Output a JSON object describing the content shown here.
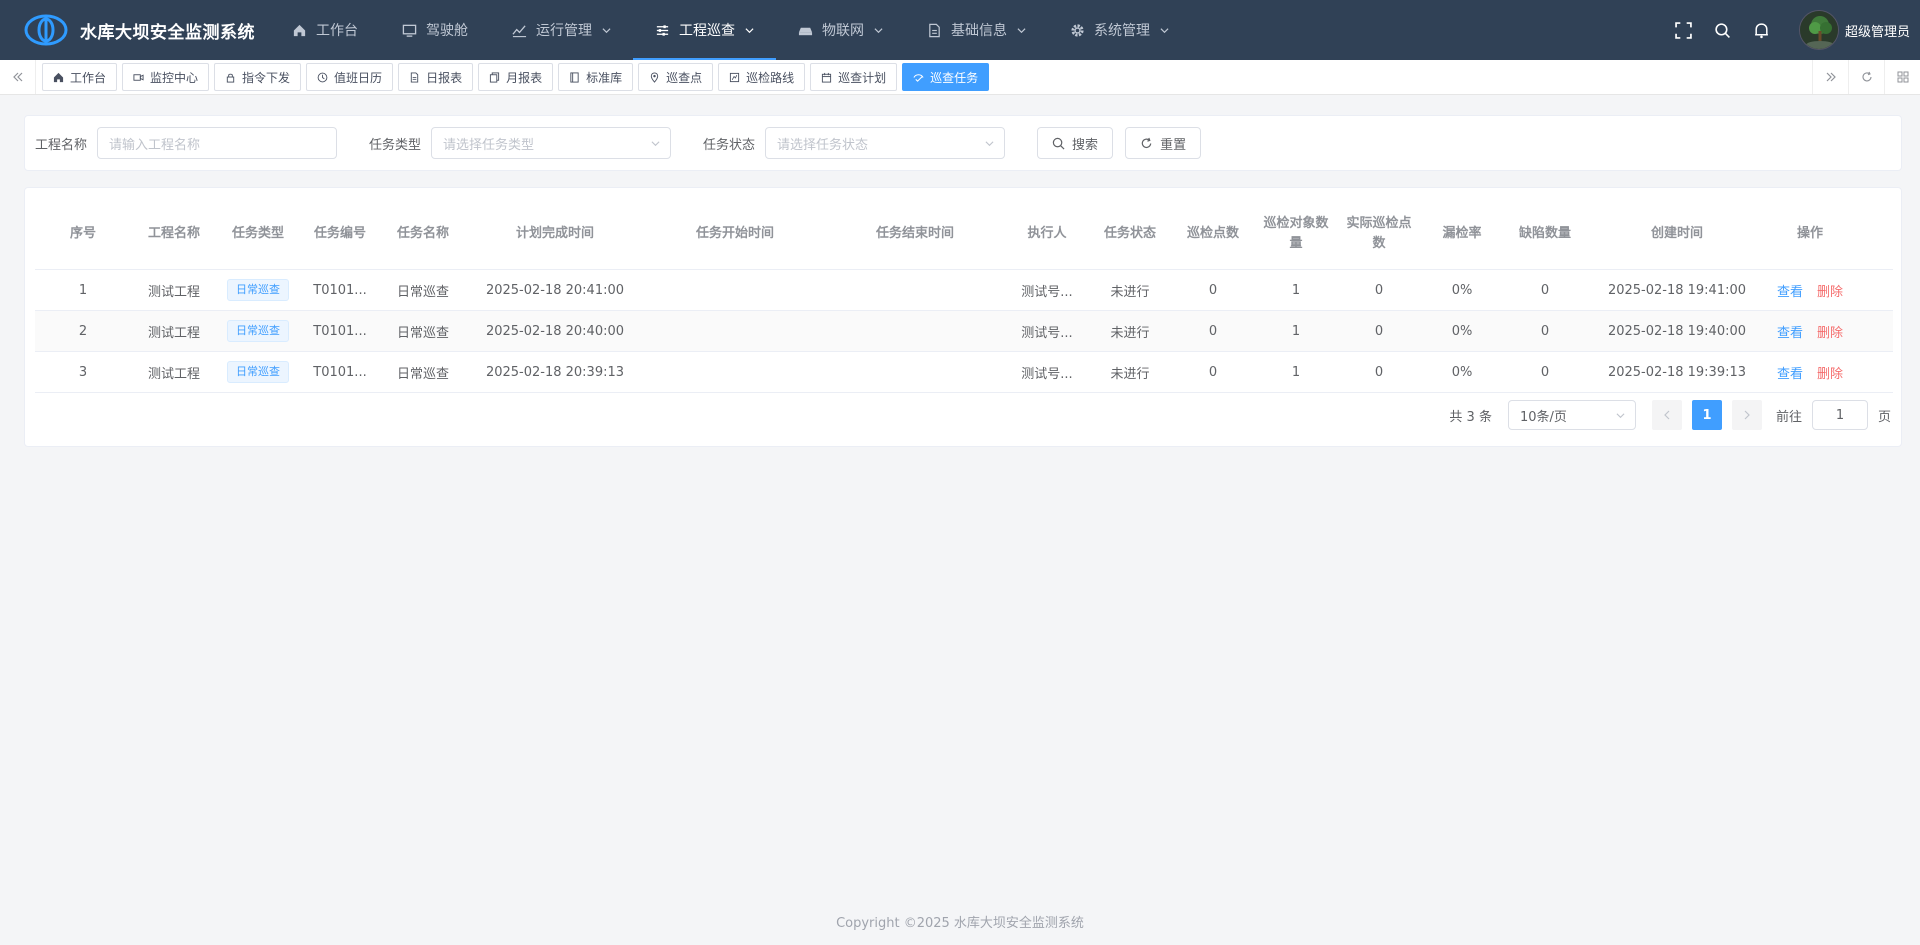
{
  "app": {
    "title": "水库大坝安全监测系统"
  },
  "nav": [
    {
      "label": "工作台",
      "icon": "home-icon",
      "dropdown": false,
      "active": false
    },
    {
      "label": "驾驶舱",
      "icon": "monitor-icon",
      "dropdown": false,
      "active": false
    },
    {
      "label": "运行管理",
      "icon": "chart-line-icon",
      "dropdown": true,
      "active": false
    },
    {
      "label": "工程巡查",
      "icon": "sliders-icon",
      "dropdown": true,
      "active": true
    },
    {
      "label": "物联网",
      "icon": "device-icon",
      "dropdown": true,
      "active": false
    },
    {
      "label": "基础信息",
      "icon": "document-icon",
      "dropdown": true,
      "active": false
    },
    {
      "label": "系统管理",
      "icon": "gear-icon",
      "dropdown": true,
      "active": false
    }
  ],
  "user": {
    "name": "超级管理员"
  },
  "tabs": [
    {
      "label": "工作台",
      "icon": "home-icon",
      "active": false
    },
    {
      "label": "监控中心",
      "icon": "camera-icon",
      "active": false
    },
    {
      "label": "指令下发",
      "icon": "lock-icon",
      "active": false
    },
    {
      "label": "值班日历",
      "icon": "clock-icon",
      "active": false
    },
    {
      "label": "日报表",
      "icon": "document-icon",
      "active": false
    },
    {
      "label": "月报表",
      "icon": "copy-icon",
      "active": false
    },
    {
      "label": "标准库",
      "icon": "book-icon",
      "active": false
    },
    {
      "label": "巡查点",
      "icon": "location-icon",
      "active": false
    },
    {
      "label": "巡检路线",
      "icon": "route-icon",
      "active": false
    },
    {
      "label": "巡查计划",
      "icon": "calendar-icon",
      "active": false
    },
    {
      "label": "巡查任务",
      "icon": "task-icon",
      "active": true
    }
  ],
  "search": {
    "project_label": "工程名称",
    "project_placeholder": "请输入工程名称",
    "type_label": "任务类型",
    "type_placeholder": "请选择任务类型",
    "status_label": "任务状态",
    "status_placeholder": "请选择任务状态",
    "search_btn": "搜索",
    "reset_btn": "重置"
  },
  "table": {
    "headers": [
      "序号",
      "工程名称",
      "任务类型",
      "任务编号",
      "任务名称",
      "计划完成时间",
      "任务开始时间",
      "任务结束时间",
      "执行人",
      "任务状态",
      "巡检点数",
      "巡检对象数量",
      "实际巡检点数",
      "漏检率",
      "缺陷数量",
      "创建时间",
      "操作"
    ],
    "rows": [
      {
        "idx": "1",
        "project": "测试工程",
        "type": "日常巡查",
        "code": "T0101...",
        "name": "日常巡查",
        "plan_time": "2025-02-18 20:41:00",
        "start": "",
        "end": "",
        "executor": "测试号...",
        "status": "未进行",
        "points": "0",
        "objects": "1",
        "actual": "0",
        "miss_rate": "0%",
        "defects": "0",
        "created": "2025-02-18 19:41:00",
        "view": "查看",
        "del": "删除"
      },
      {
        "idx": "2",
        "project": "测试工程",
        "type": "日常巡查",
        "code": "T0101...",
        "name": "日常巡查",
        "plan_time": "2025-02-18 20:40:00",
        "start": "",
        "end": "",
        "executor": "测试号...",
        "status": "未进行",
        "points": "0",
        "objects": "1",
        "actual": "0",
        "miss_rate": "0%",
        "defects": "0",
        "created": "2025-02-18 19:40:00",
        "view": "查看",
        "del": "删除"
      },
      {
        "idx": "3",
        "project": "测试工程",
        "type": "日常巡查",
        "code": "T0101...",
        "name": "日常巡查",
        "plan_time": "2025-02-18 20:39:13",
        "start": "",
        "end": "",
        "executor": "测试号...",
        "status": "未进行",
        "points": "0",
        "objects": "1",
        "actual": "0",
        "miss_rate": "0%",
        "defects": "0",
        "created": "2025-02-18 19:39:13",
        "view": "查看",
        "del": "删除"
      }
    ]
  },
  "pagination": {
    "total": "共 3 条",
    "page_size": "10条/页",
    "current": "1",
    "goto_label": "前往",
    "goto_value": "1",
    "goto_unit": "页"
  },
  "footer": {
    "text": "Copyright ©2025 水库大坝安全监测系统"
  },
  "colors": {
    "header_bg": "#304156",
    "primary": "#409eff",
    "danger": "#f56c6c"
  }
}
